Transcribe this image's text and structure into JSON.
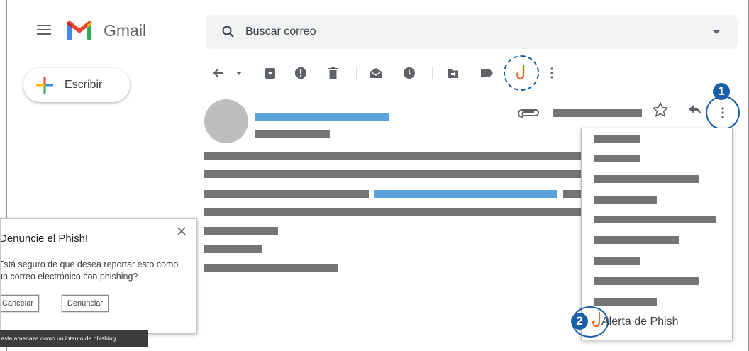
{
  "header": {
    "app_title": "Gmail",
    "search_placeholder": "Buscar correo"
  },
  "sidebar": {
    "compose_label": "Escribir"
  },
  "toolbar": {
    "icons": [
      "back-arrow-icon",
      "caret-down-icon",
      "archive-icon",
      "report-spam-icon",
      "delete-icon",
      "mark-unread-icon",
      "snooze-icon",
      "move-to-icon",
      "label-icon",
      "phish-hook-icon",
      "more-vert-icon"
    ]
  },
  "callouts": {
    "step1": "1",
    "step2": "2",
    "accent_color": "#1a5fa8"
  },
  "menu": {
    "report_item_label": "Alerta de Phish",
    "hook_color": "#f26b1d"
  },
  "dialog": {
    "title": "Denuncie el Phish!",
    "message": "Está seguro de que desea reportar esto como un correo electrónico con phishing?",
    "cancel_label": "Cancelar",
    "report_label": "Denunciar"
  },
  "tooltip": {
    "text": "r esta amenaza como un intento de phishing"
  }
}
